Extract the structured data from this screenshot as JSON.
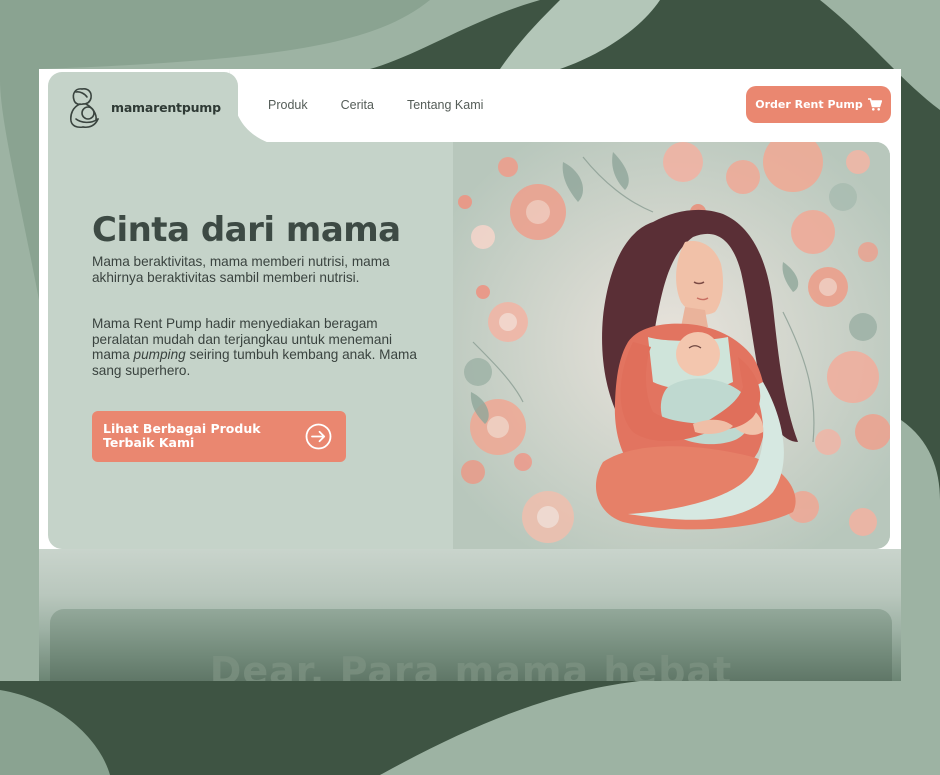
{
  "brand": {
    "name": "mamarentpump",
    "logo_icon": "mother-baby-logo-icon"
  },
  "nav": {
    "items": [
      "Produk",
      "Cerita",
      "Tentang Kami"
    ]
  },
  "header": {
    "order_button": "Order Rent Pump",
    "order_icon": "cart-icon"
  },
  "hero": {
    "title": "Cinta dari mama",
    "paragraph1": "Mama beraktivitas, mama memberi nutrisi, mama akhirnya beraktivitas sambil memberi nutrisi.",
    "paragraph2_before": "Mama Rent Pump hadir menyediakan beragam peralatan mudah dan terjangkau untuk menemani mama ",
    "paragraph2_em": "pumping",
    "paragraph2_after": " seiring tumbuh kembang anak. Mama sang superhero.",
    "cta_label": "Lihat Berbagai Produk Terbaik Kami",
    "cta_icon": "arrow-right-circle-icon",
    "illustration": "mother-holding-baby-illustration"
  },
  "next_section": {
    "title": "Dear, Para mama hebat"
  },
  "colors": {
    "accent": "#ea8770",
    "panel": "#c5d3c9",
    "background": "#3e5443",
    "text": "#3d4a44"
  }
}
